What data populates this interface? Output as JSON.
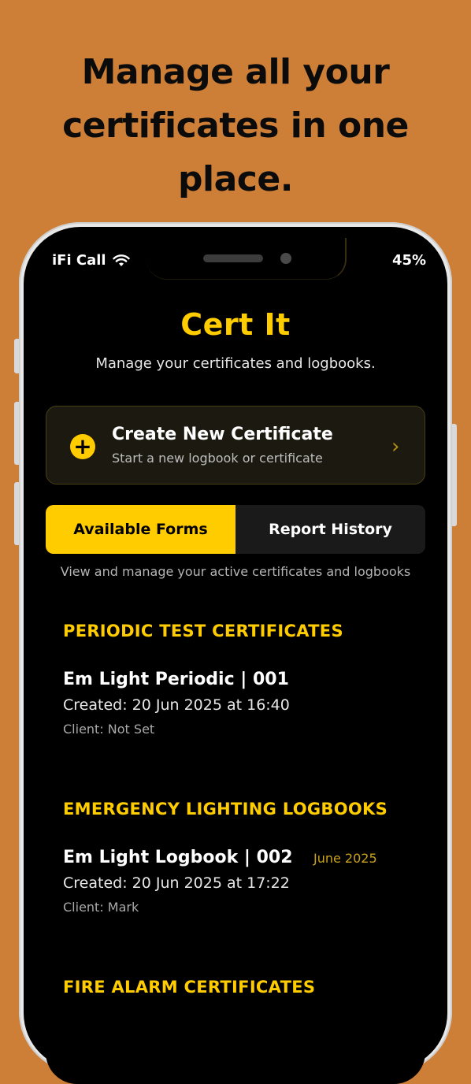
{
  "headline": {
    "line1": "Manage all your",
    "line2": "certificates in one",
    "line3": "place."
  },
  "status_bar": {
    "carrier": "iFi Call",
    "battery": "45%"
  },
  "app": {
    "title": "Cert It",
    "subtitle": "Manage your certificates and logbooks."
  },
  "create_card": {
    "title": "Create New Certificate",
    "subtitle": "Start a new logbook or certificate"
  },
  "tabs": [
    {
      "label": "Available Forms",
      "active": true
    },
    {
      "label": "Report History",
      "active": false
    }
  ],
  "tabs_note": "View and manage your active certificates and logbooks",
  "sections": [
    {
      "heading": "PERIODIC TEST CERTIFICATES",
      "items": [
        {
          "title": "Em Light Periodic | 001",
          "created": "Created: 20 Jun 2025 at 16:40",
          "client": "Client: Not Set"
        }
      ]
    },
    {
      "heading": "EMERGENCY LIGHTING LOGBOOKS",
      "items": [
        {
          "title": "Em Light Logbook | 002",
          "date_tag": "June 2025",
          "created": "Created: 20 Jun 2025 at 17:22",
          "client": "Client: Mark"
        }
      ]
    },
    {
      "heading": "FIRE ALARM CERTIFICATES",
      "items": []
    }
  ],
  "colors": {
    "background": "#CD7F37",
    "accent": "#FFCC00",
    "screen": "#000000"
  }
}
